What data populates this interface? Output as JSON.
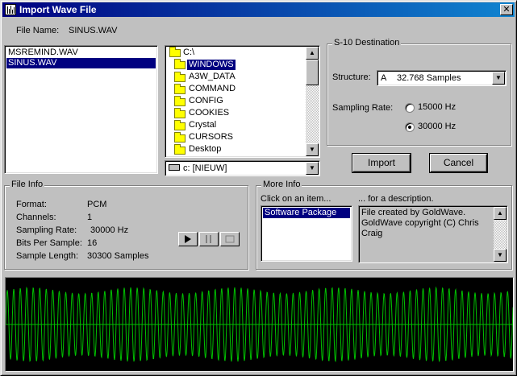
{
  "window": {
    "title": "Import Wave File",
    "close_glyph": "✕"
  },
  "file_name": {
    "label": "File Name:",
    "value": "SINUS.WAV"
  },
  "file_list": {
    "items": [
      {
        "label": "MSREMIND.WAV",
        "selected": false
      },
      {
        "label": "SINUS.WAV",
        "selected": true
      }
    ]
  },
  "folder_tree": {
    "items": [
      {
        "label": "C:\\",
        "icon": "open-folder-icon",
        "selected": false,
        "indent": 0
      },
      {
        "label": "WINDOWS",
        "icon": "open-folder-icon",
        "selected": true,
        "indent": 1
      },
      {
        "label": "A3W_DATA",
        "icon": "folder-icon",
        "selected": false,
        "indent": 2
      },
      {
        "label": "COMMAND",
        "icon": "folder-icon",
        "selected": false,
        "indent": 2
      },
      {
        "label": "CONFIG",
        "icon": "folder-icon",
        "selected": false,
        "indent": 2
      },
      {
        "label": "COOKIES",
        "icon": "folder-icon",
        "selected": false,
        "indent": 2
      },
      {
        "label": "Crystal",
        "icon": "folder-icon",
        "selected": false,
        "indent": 2
      },
      {
        "label": "CURSORS",
        "icon": "folder-icon",
        "selected": false,
        "indent": 2
      },
      {
        "label": "Desktop",
        "icon": "folder-icon",
        "selected": false,
        "indent": 2
      }
    ]
  },
  "drive": {
    "value": "c: [NIEUW]",
    "icon": "drive-icon"
  },
  "destination": {
    "group_label": "S-10 Destination",
    "structure_label": "Structure:",
    "structure_letter": "A",
    "structure_value": "32.768 Samples",
    "sampling_rate_label": "Sampling Rate:",
    "rates": [
      {
        "label": "15000 Hz",
        "checked": false
      },
      {
        "label": "30000 Hz",
        "checked": true
      }
    ]
  },
  "buttons": {
    "import": "Import",
    "cancel": "Cancel"
  },
  "file_info": {
    "group_label": "File Info",
    "rows": [
      {
        "label": "Format:",
        "value": "PCM"
      },
      {
        "label": "Channels:",
        "value": "1"
      },
      {
        "label": "Sampling Rate:",
        "value": "30000 Hz"
      },
      {
        "label": "Bits Per Sample:",
        "value": "16"
      },
      {
        "label": "Sample Length:",
        "value": "30300 Samples"
      }
    ]
  },
  "more_info": {
    "group_label": "More Info",
    "click_prompt": "Click on an item...",
    "description_prompt": "... for a description.",
    "items": [
      {
        "label": "Software Package",
        "selected": true
      }
    ],
    "description": "File created by GoldWave. GoldWave copyright (C) Chris Craig"
  },
  "waveform": {
    "color": "#00c000",
    "background": "#000000"
  },
  "colors": {
    "title_start": "#000080",
    "title_end": "#1084d0",
    "selection": "#000080",
    "face": "#c0c0c0"
  }
}
